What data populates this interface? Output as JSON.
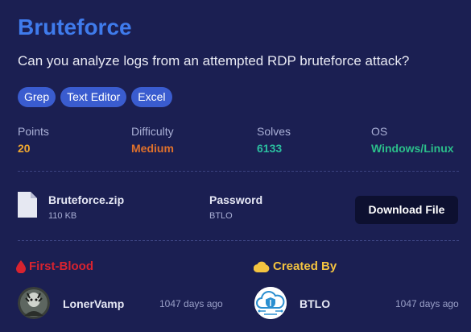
{
  "challenge": {
    "title": "Bruteforce",
    "description": "Can you analyze logs from an attempted RDP bruteforce attack?",
    "tags": [
      "Grep",
      "Text Editor",
      "Excel"
    ]
  },
  "stats": [
    {
      "label": "Points",
      "value": "20",
      "color": "#f0a830"
    },
    {
      "label": "Difficulty",
      "value": "Medium",
      "color": "#e0712b"
    },
    {
      "label": "Solves",
      "value": "6133",
      "color": "#2bbfa0"
    },
    {
      "label": "OS",
      "value": "Windows/Linux",
      "color": "#2bbf8a"
    }
  ],
  "file": {
    "name": "Bruteforce.zip",
    "size": "110 KB",
    "password_label": "Password",
    "password_value": "BTLO",
    "download_label": "Download File",
    "icon": "file-icon"
  },
  "first_blood": {
    "heading": "First-Blood",
    "icon": "blood-drop-icon",
    "user": "LonerVamp",
    "time": "1047 days ago"
  },
  "created_by": {
    "heading": "Created By",
    "icon": "cloud-icon",
    "user": "BTLO",
    "time": "1047 days ago"
  },
  "colors": {
    "background": "#1b1f52",
    "accent": "#3f7bec",
    "tag": "#3a5ccf",
    "first_blood": "#d8232f",
    "created_by": "#f3c340"
  }
}
